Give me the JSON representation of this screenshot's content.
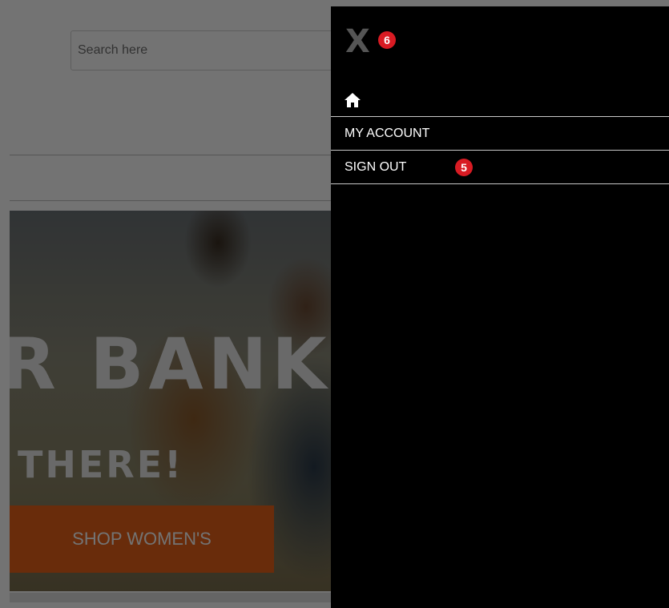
{
  "search": {
    "placeholder": "Search here"
  },
  "hero": {
    "headline": "R BANK",
    "subheadline": "THERE!",
    "cta_label": "SHOP WOMEN'S",
    "cta_color": "#e8631a"
  },
  "drawer": {
    "close_label": "X",
    "close_badge": "6",
    "items": [
      {
        "label": "",
        "icon": "home-icon"
      },
      {
        "label": "MY ACCOUNT"
      },
      {
        "label": "SIGN OUT",
        "badge": "5"
      }
    ]
  },
  "colors": {
    "drawer_bg": "#000000",
    "badge_bg": "#d81b23",
    "divider": "#c8c8c8"
  }
}
